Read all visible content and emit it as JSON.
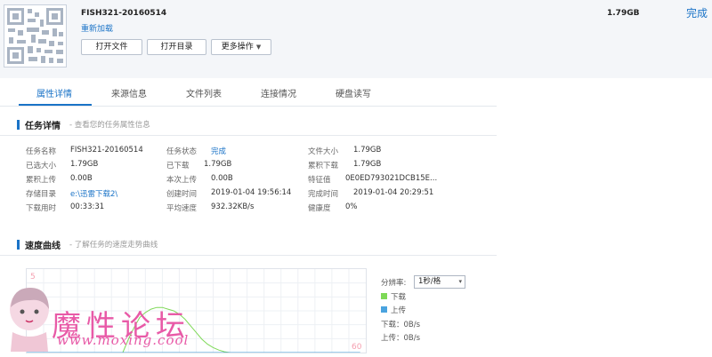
{
  "header": {
    "filename": "FISH321-20160514",
    "reload_label": "重新加载",
    "buttons": {
      "open_file": "打开文件",
      "open_dir": "打开目录",
      "more": "更多操作"
    },
    "size": "1.79GB",
    "status_link": "完成"
  },
  "tabs": [
    "属性详情",
    "来源信息",
    "文件列表",
    "连接情况",
    "硬盘读写"
  ],
  "active_tab": 0,
  "details": {
    "title": "任务详情",
    "subtitle": "- 查看您的任务属性信息",
    "rows": [
      [
        {
          "label": "任务名称",
          "value": "FISH321-20160514"
        },
        {
          "label": "任务状态",
          "value": "完成"
        },
        {
          "label": "文件大小",
          "value": "1.79GB"
        }
      ],
      [
        {
          "label": "已选大小",
          "value": "1.79GB"
        },
        {
          "label": "已下载",
          "value": "1.79GB"
        },
        {
          "label": "累积下载",
          "value": "1.79GB"
        }
      ],
      [
        {
          "label": "累积上传",
          "value": "0.00B"
        },
        {
          "label": "本次上传",
          "value": "0.00B"
        },
        {
          "label": "特征值",
          "value": "0E0ED793021DCB15E..."
        }
      ],
      [
        {
          "label": "存储目录",
          "value": "e:\\迅雷下载2\\"
        },
        {
          "label": "创建时间",
          "value": "2019-01-04 19:56:14"
        },
        {
          "label": "完成时间",
          "value": "2019-01-04 20:29:51"
        }
      ],
      [
        {
          "label": "下载用时",
          "value": "00:33:31"
        },
        {
          "label": "平均速度",
          "value": "932.32KB/s"
        },
        {
          "label": "健康度",
          "value": "0%"
        }
      ]
    ]
  },
  "speed": {
    "title": "速度曲线",
    "subtitle": "- 了解任务的速度走势曲线",
    "ymax_label": "5",
    "xmax_label": "60",
    "resolution_label": "分辨率:",
    "resolution_value": "1秒/格",
    "legend_download": "下载",
    "legend_upload": "上传",
    "download_rate": "下载：0B/s",
    "upload_rate": "上传：0B/s",
    "colors": {
      "download": "#7ed957",
      "upload": "#4aa3df"
    }
  },
  "chart_data": {
    "type": "line",
    "series": [
      {
        "name": "下载",
        "values": [
          0,
          0,
          0,
          0,
          0,
          0,
          0,
          0,
          0,
          0,
          0,
          0,
          0,
          0,
          0,
          0,
          0,
          0,
          0.8,
          1.5,
          2.1,
          2.4,
          2.6,
          2.7,
          2.7,
          2.6,
          2.5,
          2.3,
          2.0,
          1.6,
          1.2,
          0.8,
          0.5,
          0.3,
          0.15,
          0.05,
          0,
          0,
          0,
          0,
          0,
          0,
          0,
          0,
          0,
          0,
          0,
          0,
          0,
          0,
          0,
          0,
          0,
          0,
          0,
          0,
          0,
          0,
          0,
          0
        ]
      },
      {
        "name": "上传",
        "values": [
          0,
          0,
          0,
          0,
          0,
          0,
          0,
          0,
          0,
          0,
          0,
          0,
          0,
          0,
          0,
          0,
          0,
          0,
          0,
          0,
          0,
          0,
          0,
          0,
          0,
          0,
          0,
          0,
          0,
          0,
          0,
          0,
          0,
          0,
          0,
          0,
          0,
          0,
          0,
          0,
          0,
          0,
          0,
          0,
          0,
          0,
          0,
          0,
          0,
          0,
          0,
          0,
          0,
          0,
          0,
          0,
          0,
          0,
          0,
          0
        ]
      }
    ],
    "ylim": [
      0,
      5
    ],
    "xlim": [
      0,
      60
    ],
    "grid": true
  },
  "watermark": {
    "text": "魔性论坛",
    "url": "www.moxing.cool"
  }
}
